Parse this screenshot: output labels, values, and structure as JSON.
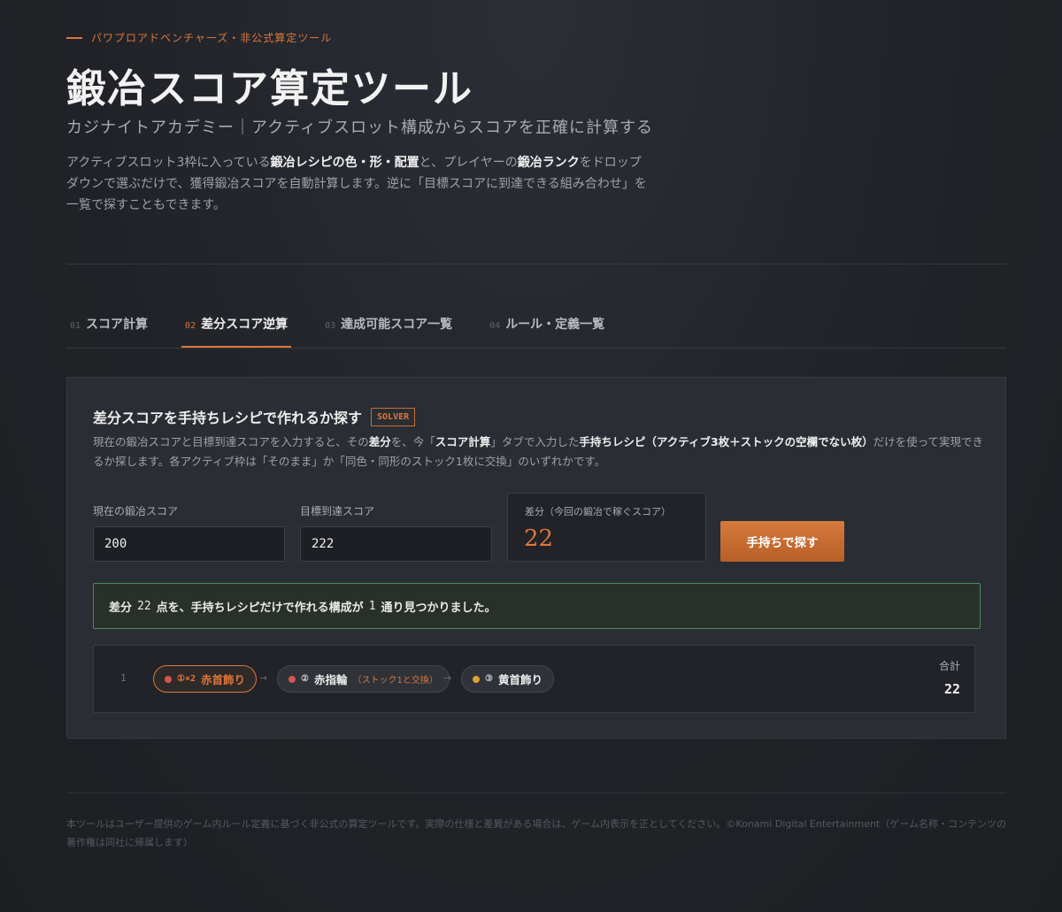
{
  "header": {
    "eyebrow": "パワプロアドベンチャーズ・非公式算定ツール",
    "title": "鍛冶スコア算定ツール",
    "subtitle": "カジナイトアカデミー｜アクティブスロット構成からスコアを正確に計算する",
    "intro": {
      "p1": "アクティブスロット3枠に入っている",
      "b1": "鍛冶レシピの色・形・配置",
      "p2": "と、プレイヤーの",
      "b2": "鍛冶ランク",
      "p3": "をドロップダウンで選ぶだけで、獲得鍛冶スコアを自動計算します。逆に「目標スコアに到達できる組み合わせ」を一覧で探すこともできます。"
    }
  },
  "tabs": [
    {
      "num": "01",
      "label": "スコア計算",
      "active": false
    },
    {
      "num": "02",
      "label": "差分スコア逆算",
      "active": true
    },
    {
      "num": "03",
      "label": "達成可能スコア一覧",
      "active": false
    },
    {
      "num": "04",
      "label": "ルール・定義一覧",
      "active": false
    }
  ],
  "solver": {
    "title": "差分スコアを手持ちレシピで作れるか探す",
    "badge": "SOLVER",
    "desc": {
      "p1": "現在の鍛冶スコアと目標到達スコアを入力すると、その",
      "b1": "差分",
      "p2": "を、今「",
      "b2": "スコア計算",
      "p3": "」タブで入力した",
      "b3": "手持ちレシピ（アクティブ3枚＋ストックの空欄でない枚）",
      "p4": "だけを使って実現できるか探します。各アクティブ枠は「そのまま」か「同色・同形のストック1枚に交換」のいずれかです。"
    },
    "current_label": "現在の鍛冶スコア",
    "current_value": "200",
    "target_label": "目標到達スコア",
    "target_value": "222",
    "diff_label": "差分（今回の鍛冶で稼ぐスコア）",
    "diff_value": "22",
    "search_button": "手持ちで探す",
    "result": {
      "p1": "差分",
      "diff": "22",
      "p2": "点を、手持ちレシピだけで作れる構成が",
      "count": "1",
      "p3": "通り見つかりました。"
    },
    "solutions": [
      {
        "index": "1",
        "chips": [
          {
            "slot": "①×2",
            "name": "赤首飾り",
            "color": "#d9534f",
            "note": "",
            "highlight": true
          },
          {
            "slot": "②",
            "name": "赤指輪",
            "color": "#d9534f",
            "note": "（ストック1と交換）",
            "highlight": false
          },
          {
            "slot": "③",
            "name": "黄首飾り",
            "color": "#e0a030",
            "note": "",
            "highlight": false
          }
        ],
        "arrow": "→",
        "total_label": "合計",
        "total_value": "22"
      }
    ]
  },
  "footer": {
    "text": "本ツールはユーザー提供のゲーム内ルール定義に基づく非公式の算定ツールです。実際の仕様と差異がある場合は、ゲーム内表示を正としてください。©Konami Digital Entertainment（ゲーム名称・コンテンツの著作権は同社に帰属します）"
  }
}
